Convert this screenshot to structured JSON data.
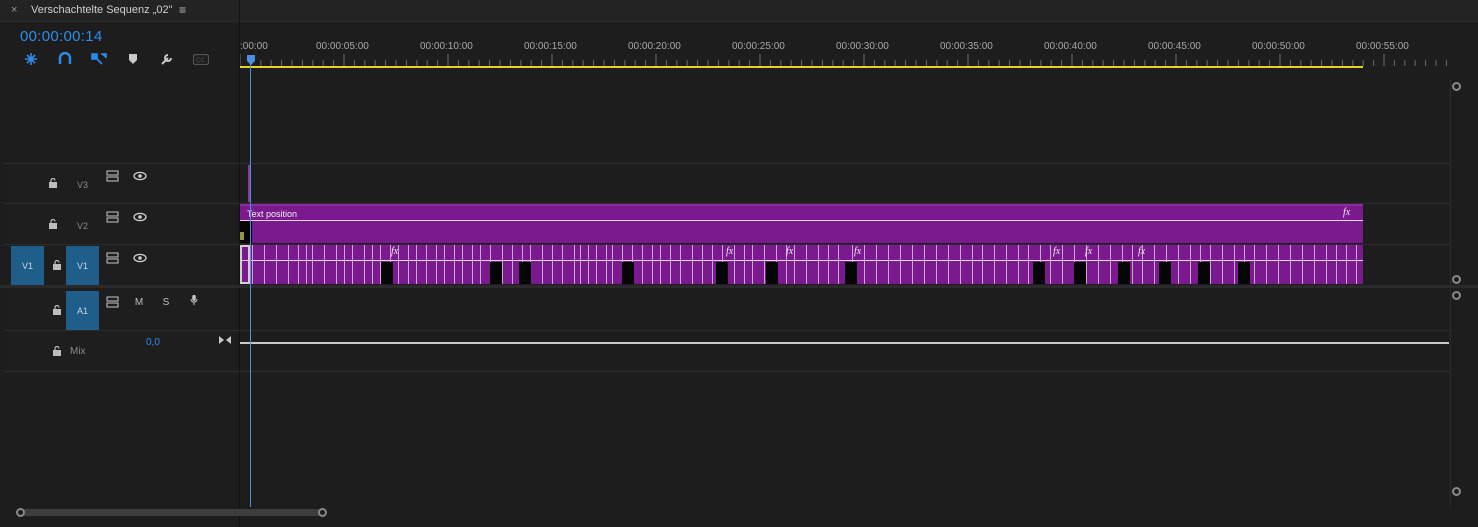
{
  "panel": {
    "close_glyph": "×",
    "title": "Verschachtelte Sequenz „02\"",
    "menu_glyph": "≡"
  },
  "timecode": "00:00:00:14",
  "toolbar": {
    "icons": [
      "nest-icon",
      "snap-icon",
      "linked-selection-icon",
      "marker-icon",
      "wrench-icon",
      "captions-icon"
    ]
  },
  "ruler": {
    "labels": [
      ":00:00",
      "00:00:05:00",
      "00:00:10:00",
      "00:00:15:00",
      "00:00:20:00",
      "00:00:25:00",
      "00:00:30:00",
      "00:00:35:00",
      "00:00:40:00",
      "00:00:45:00",
      "00:00:50:00",
      "00:00:55:00"
    ]
  },
  "tracks": {
    "v3": {
      "name": "V3"
    },
    "v2": {
      "name": "V2"
    },
    "v1": {
      "source": "V1",
      "name": "V1"
    },
    "a1": {
      "name": "A1",
      "mute": "M",
      "solo": "S"
    },
    "mix": {
      "name": "Mix",
      "value": "0,0"
    }
  },
  "clips": {
    "v2_label": "Text position",
    "fx": "fx"
  },
  "colors": {
    "accent": "#2d8ceb",
    "clip": "#7a1a8e",
    "work_area": "#e6d422"
  }
}
